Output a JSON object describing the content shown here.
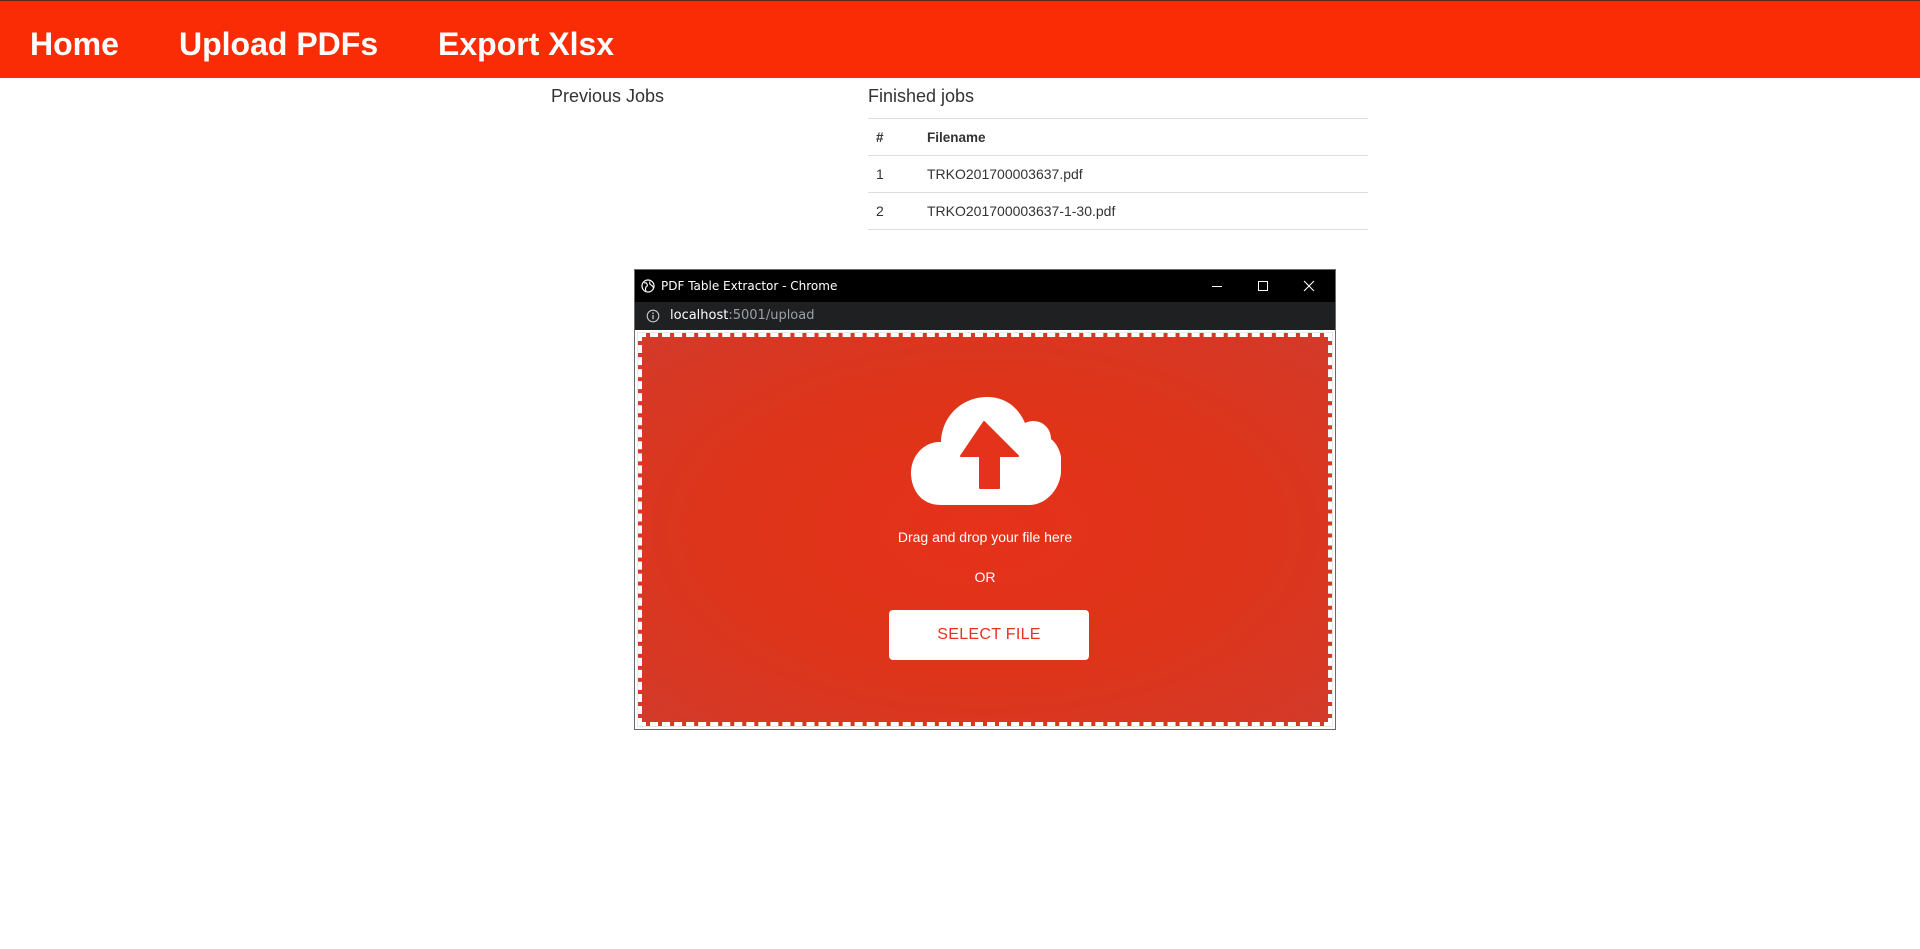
{
  "nav": {
    "items": [
      "Home",
      "Upload PDFs",
      "Export Xlsx"
    ]
  },
  "sections": {
    "previous_jobs": "Previous Jobs",
    "finished_jobs": "Finished jobs"
  },
  "jobs_table": {
    "headers": [
      "#",
      "Filename"
    ],
    "rows": [
      [
        "1",
        "TRKO201700003637.pdf"
      ],
      [
        "2",
        "TRKO201700003637-1-30.pdf"
      ]
    ]
  },
  "chrome_window": {
    "title": "PDF Table Extractor - Chrome",
    "url_host": "localhost",
    "url_path": ":5001/upload",
    "icons": [
      "globe-icon",
      "info-icon",
      "minimize-icon",
      "maximize-icon",
      "close-icon"
    ]
  },
  "dropzone": {
    "icon": "cloud-upload-icon",
    "instruction": "Drag and drop your file here",
    "or_label": "OR",
    "select_label": "SELECT FILE"
  },
  "colors": {
    "navbar": "#f92c06",
    "dropzone": "#e2321a",
    "button_text": "#e7321c"
  }
}
